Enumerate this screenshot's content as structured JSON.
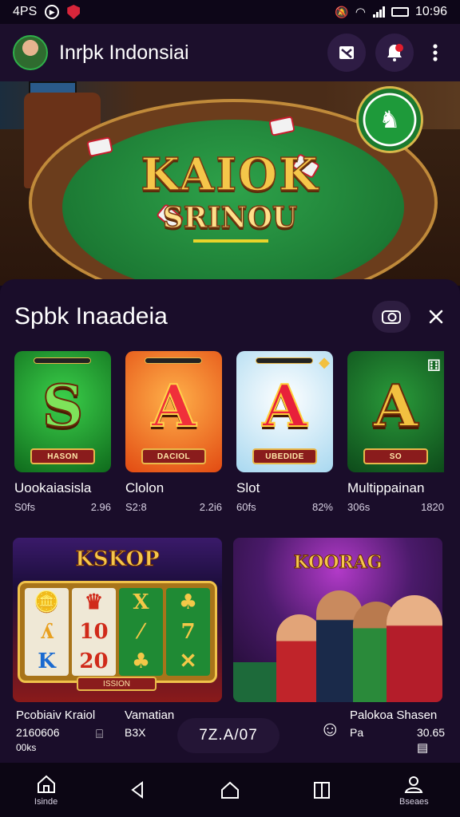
{
  "status_bar": {
    "time_left": "4PS",
    "time_right": "10:96"
  },
  "header": {
    "title": "Inrþk Indonsiai"
  },
  "hero": {
    "logo_line1": "KAIOK",
    "logo_line2": "SRINOU"
  },
  "sheet": {
    "title": "Spbk Inaadeia"
  },
  "cards": [
    {
      "name": "Uookaiasisla",
      "meta_left": "S0fs",
      "meta_right": "2.96",
      "letter": "S",
      "plate": "HASON"
    },
    {
      "name": "Clolon",
      "meta_left": "S2:8",
      "meta_right": "2.2i6",
      "letter": "A",
      "plate": "DACIOL"
    },
    {
      "name": "Slot",
      "meta_left": "60fs",
      "meta_right": "82%",
      "letter": "A",
      "plate": "UBEDIDE"
    },
    {
      "name": "Multippainan",
      "meta_left": "306s",
      "meta_right": "1820",
      "letter": "A",
      "plate": "SO"
    }
  ],
  "promos": {
    "left": {
      "logo": "KSKOP",
      "plate": "ISSION",
      "title": "Pcobiaiv Kraiol",
      "line2": "2160606",
      "line3": "00ks"
    },
    "middle": {
      "title": "Vamatian",
      "line2": "B3X"
    },
    "right": {
      "logo": "KOORAG",
      "title": "Palokoa Shasen",
      "line2": "Pa",
      "line3": "30.65"
    }
  },
  "pill": {
    "label": "7Z.A/07"
  },
  "nav": [
    {
      "label": "Isinde",
      "icon": "home-outline-icon"
    },
    {
      "label": "",
      "icon": "back-icon"
    },
    {
      "label": "",
      "icon": "home-icon"
    },
    {
      "label": "",
      "icon": "recents-icon"
    },
    {
      "label": "Bseaes",
      "icon": "profile-icon"
    }
  ]
}
